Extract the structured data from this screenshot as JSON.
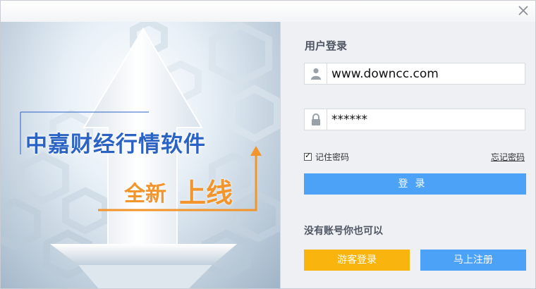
{
  "window": {
    "close_icon": "close-icon"
  },
  "hero": {
    "title": "中嘉财经行情软件",
    "subtitle_part1": "全新",
    "subtitle_part2": "上线",
    "accent_color": "#f2952c",
    "title_color": "#2b63c5"
  },
  "login": {
    "title": "用户登录",
    "username_value": "www.downcc.com",
    "password_value": "******",
    "username_icon": "user-icon",
    "password_icon": "lock-icon",
    "remember_label": "记住密码",
    "remember_checked": true,
    "forgot_label": "忘记密码",
    "submit_label": "登录",
    "alt_title": "没有账号你也可以",
    "guest_label": "游客登录",
    "register_label": "马上注册",
    "primary_color": "#4ca2f6",
    "guest_color": "#f9b40d"
  }
}
